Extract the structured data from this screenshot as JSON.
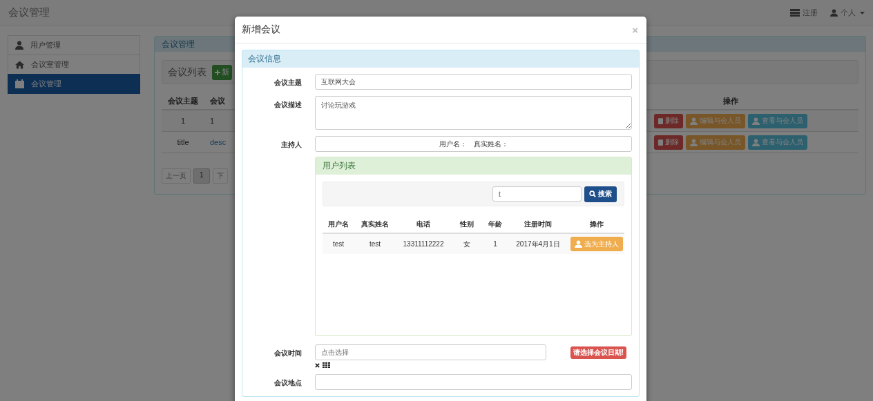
{
  "navbar": {
    "brand": "会议管理",
    "register": "注册",
    "user": "个人"
  },
  "sidebar": {
    "items": [
      {
        "label": "用户管理",
        "selected": false
      },
      {
        "label": "会议室管理",
        "selected": false
      },
      {
        "label": "会议管理",
        "selected": true
      }
    ]
  },
  "panel": {
    "title": "会议管理",
    "list_title": "会议列表",
    "add_button": "新",
    "columns": [
      "会议主题",
      "会议"
    ],
    "action_column": "操作",
    "rows": [
      {
        "cells": [
          "1",
          "1"
        ],
        "actions": [
          {
            "kind": "danger",
            "label": "删除"
          },
          {
            "kind": "warning",
            "label": "编辑与会人员"
          },
          {
            "kind": "info",
            "label": "查看与会人员"
          }
        ]
      },
      {
        "cells": [
          "title",
          "desc"
        ],
        "actions": [
          {
            "kind": "danger",
            "label": "删除"
          },
          {
            "kind": "warning",
            "label": "编辑与会人员"
          },
          {
            "kind": "info",
            "label": "查看与会人员"
          }
        ]
      }
    ],
    "pagination": [
      {
        "label": "上一页",
        "selected": false
      },
      {
        "label": "1",
        "selected": true
      },
      {
        "label": "下",
        "selected": false
      }
    ]
  },
  "modal": {
    "title": "新增会议",
    "close": "×",
    "section_title": "会议信息",
    "fields": [
      {
        "kind": "input",
        "label": "会议主题",
        "value": "互联网大会"
      },
      {
        "kind": "textarea",
        "label": "会议描述",
        "value": "讨论玩游戏"
      },
      {
        "kind": "host",
        "label": "主持人",
        "parts": [
          "用户名：",
          "真实姓名："
        ]
      }
    ],
    "user_list": {
      "title": "用户列表",
      "search_value": "t",
      "search_button": "搜索",
      "columns": [
        "用户名",
        "真实姓名",
        "电话",
        "性别",
        "年龄",
        "注册时间",
        "操作"
      ],
      "rows": [
        {
          "cells": [
            "test",
            "test",
            "13311112222",
            "女",
            "1",
            "2017年4月1日"
          ],
          "action": "选为主持人"
        }
      ]
    },
    "time": {
      "label": "会议时间",
      "placeholder": "点击选择",
      "error": "请选择会议日期!"
    },
    "place": {
      "label": "会议地点"
    }
  }
}
